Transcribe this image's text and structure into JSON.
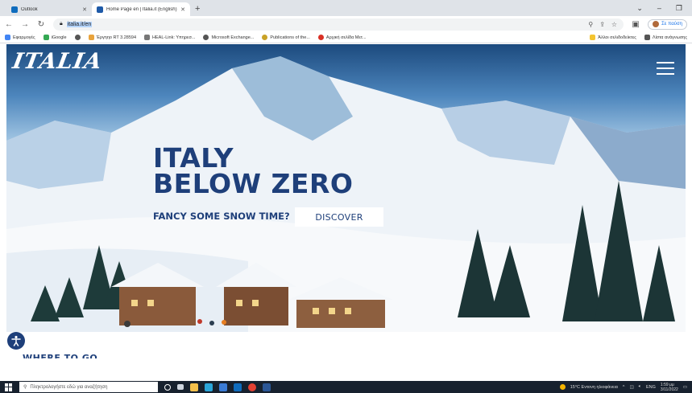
{
  "browser": {
    "tabs": [
      {
        "label": "Outlook",
        "favicon_color": "#0f6cbd",
        "active": false
      },
      {
        "label": "Home Page en | Italia.it (English)",
        "favicon_color": "#1e5aa8",
        "active": true
      }
    ],
    "new_tab_label": "+",
    "url": "italia.it/en",
    "profile_label": "Σε παύση",
    "bookmarks": [
      {
        "label": "Εφαρμογές",
        "color": "#4285f4"
      },
      {
        "label": "iGoogle",
        "color": "#34a853"
      },
      {
        "label": "",
        "color": "#555555"
      },
      {
        "label": "Έργηηο RT 3.28594",
        "color": "#e8a33d"
      },
      {
        "label": "HEAL-Link: Υπηρεσ...",
        "color": "#777777"
      },
      {
        "label": "Microsoft Exchange...",
        "color": "#555555"
      },
      {
        "label": "Publications of the...",
        "color": "#c9a227"
      },
      {
        "label": "Αρχική σελίδα Μετ...",
        "color": "#d93025"
      }
    ],
    "bookmarks_right": [
      {
        "label": "Άλλοι σελιδοδείκτες",
        "color": "#f4c430"
      },
      {
        "label": "Λίστα ανάγνωσης",
        "color": "#555555"
      }
    ]
  },
  "page": {
    "logo": "ITALIA",
    "hero": {
      "title_line1": "ITALY",
      "title_line2": "BELOW ZERO",
      "subtitle": "FANCY SOME SNOW TIME?",
      "cta": "DISCOVER"
    },
    "section_peek": "WHERE TO GO"
  },
  "taskbar": {
    "search_placeholder": "Πληκτρολογήστε εδώ για αναζήτηση",
    "weather": "15°C Εντονη ηλιοφάνεια",
    "lang": "ENG",
    "time": "1:59 μμ",
    "date": "3/11/2022",
    "apps": [
      {
        "name": "task-view",
        "color": "#cfd6df"
      },
      {
        "name": "explorer",
        "color": "#f3c04b"
      },
      {
        "name": "edge",
        "color": "#2aa5d9"
      },
      {
        "name": "mail",
        "color": "#3a7bd5"
      },
      {
        "name": "outlook",
        "color": "#0f6cbd"
      },
      {
        "name": "chrome",
        "color": "#e34133"
      },
      {
        "name": "word",
        "color": "#2b5797"
      }
    ]
  },
  "colors": {
    "brand_blue": "#1e3f7a",
    "accent_blue": "#1a73e8"
  }
}
